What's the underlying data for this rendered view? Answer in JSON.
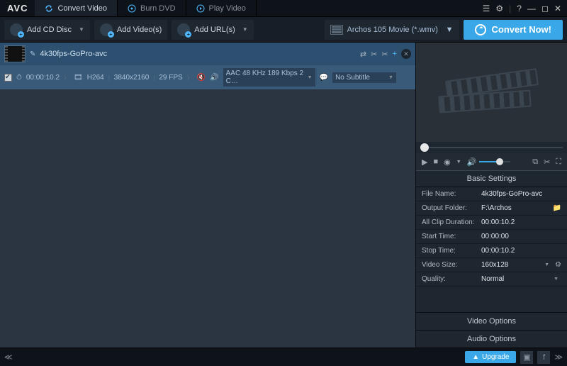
{
  "app": {
    "logo": "AVC"
  },
  "tabs": [
    {
      "label": "Convert Video",
      "active": true
    },
    {
      "label": "Burn DVD",
      "active": false
    },
    {
      "label": "Play Video",
      "active": false
    }
  ],
  "toolbar": {
    "add_cd": "Add CD Disc",
    "add_videos": "Add Video(s)",
    "add_urls": "Add URL(s)",
    "profile": "Archos 105 Movie (*.wmv)",
    "convert": "Convert Now!"
  },
  "item": {
    "filename": "4k30fps-GoPro-avc",
    "duration": "00:00:10.2",
    "vcodec": "H264",
    "resolution": "3840x2160",
    "fps": "29 FPS",
    "audio": "AAC 48 KHz 189 Kbps 2 C…",
    "subtitle": "No Subtitle"
  },
  "settings": {
    "title": "Basic Settings",
    "rows": {
      "file_name": {
        "label": "File Name:",
        "value": "4k30fps-GoPro-avc"
      },
      "output_folder": {
        "label": "Output Folder:",
        "value": "F:\\Archos"
      },
      "clip_duration": {
        "label": "All Clip Duration:",
        "value": "00:00:10.2"
      },
      "start_time": {
        "label": "Start Time:",
        "value": "00:00:00"
      },
      "stop_time": {
        "label": "Stop Time:",
        "value": "00:00:10.2"
      },
      "video_size": {
        "label": "Video Size:",
        "value": "160x128"
      },
      "quality": {
        "label": "Quality:",
        "value": "Normal"
      }
    },
    "video_opts": "Video Options",
    "audio_opts": "Audio Options"
  },
  "bottombar": {
    "upgrade": "Upgrade"
  }
}
